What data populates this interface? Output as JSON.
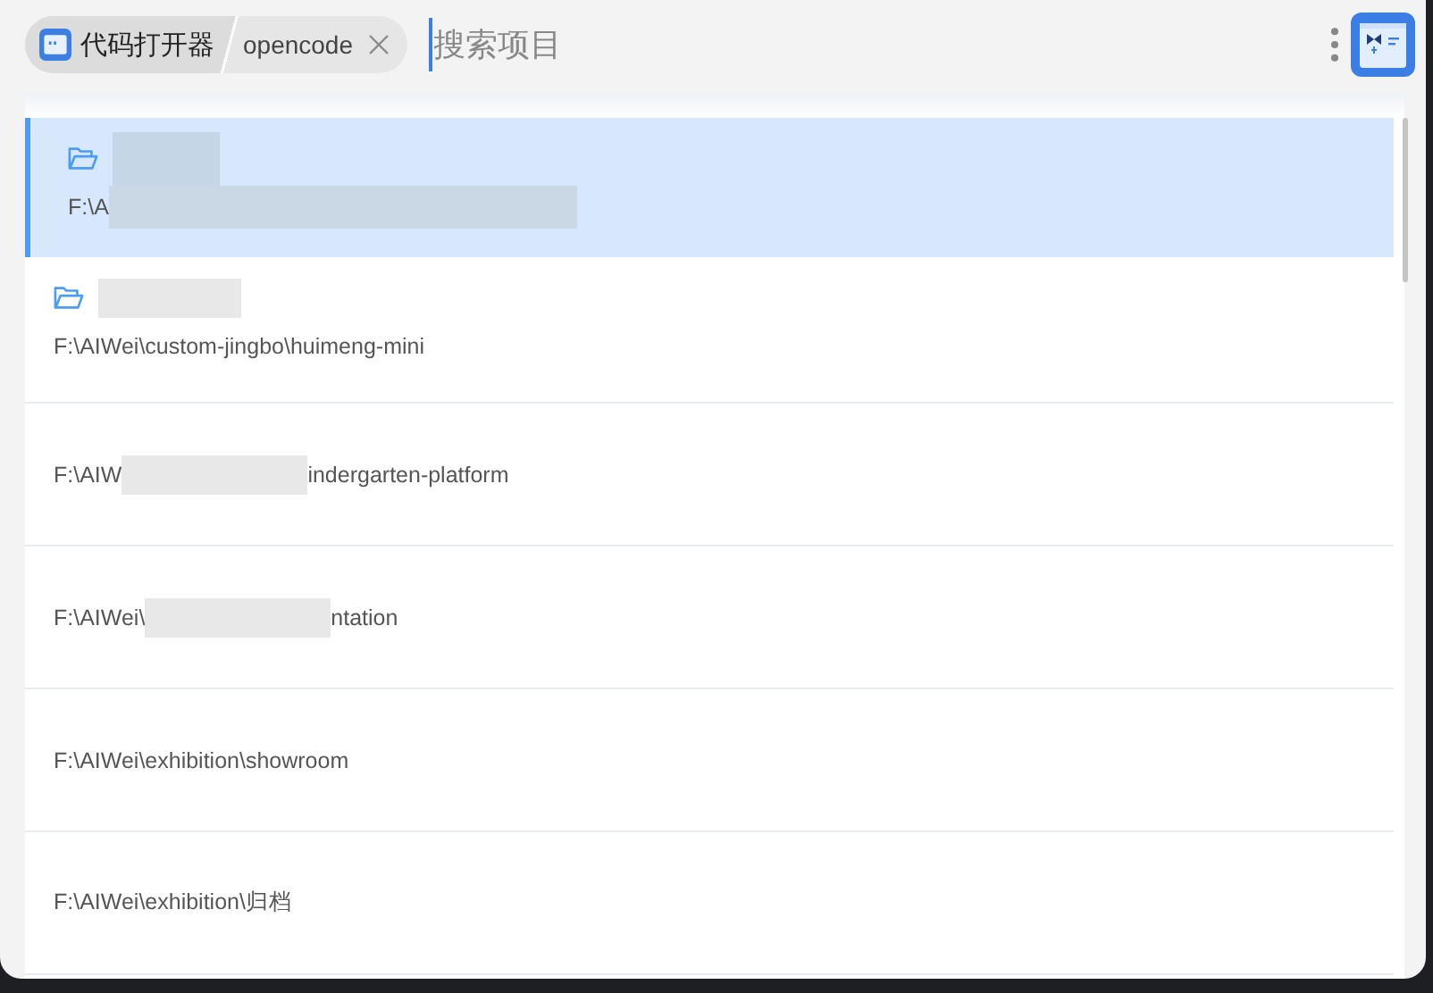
{
  "header": {
    "app_title": "代码打开器",
    "crumb": "opencode",
    "search": {
      "placeholder": "搜索项目"
    }
  },
  "projects": [
    {
      "kind": "named",
      "selected": true,
      "path": [
        {
          "kind": "text",
          "text": "F:\\A"
        },
        {
          "kind": "redacted"
        }
      ]
    },
    {
      "kind": "named",
      "selected": false,
      "path": [
        {
          "kind": "text",
          "text": "F:\\AIWei\\custom-jingbo\\huimeng-mini"
        }
      ]
    },
    {
      "kind": "path_only",
      "selected": false,
      "path": [
        {
          "kind": "text",
          "text": "F:\\AIW"
        },
        {
          "kind": "redacted"
        },
        {
          "kind": "text",
          "text": "indergarten-platform"
        }
      ]
    },
    {
      "kind": "path_only",
      "selected": false,
      "path": [
        {
          "kind": "text",
          "text": "F:\\AIWei\\"
        },
        {
          "kind": "redacted"
        },
        {
          "kind": "text",
          "text": "ntation"
        }
      ]
    },
    {
      "kind": "path_only",
      "selected": false,
      "path": [
        {
          "kind": "text",
          "text": "F:\\AIWei\\exhibition\\showroom"
        }
      ]
    },
    {
      "kind": "path_only",
      "selected": false,
      "path": [
        {
          "kind": "text",
          "text": "F:\\AIWei\\exhibition\\归档"
        }
      ]
    }
  ]
}
